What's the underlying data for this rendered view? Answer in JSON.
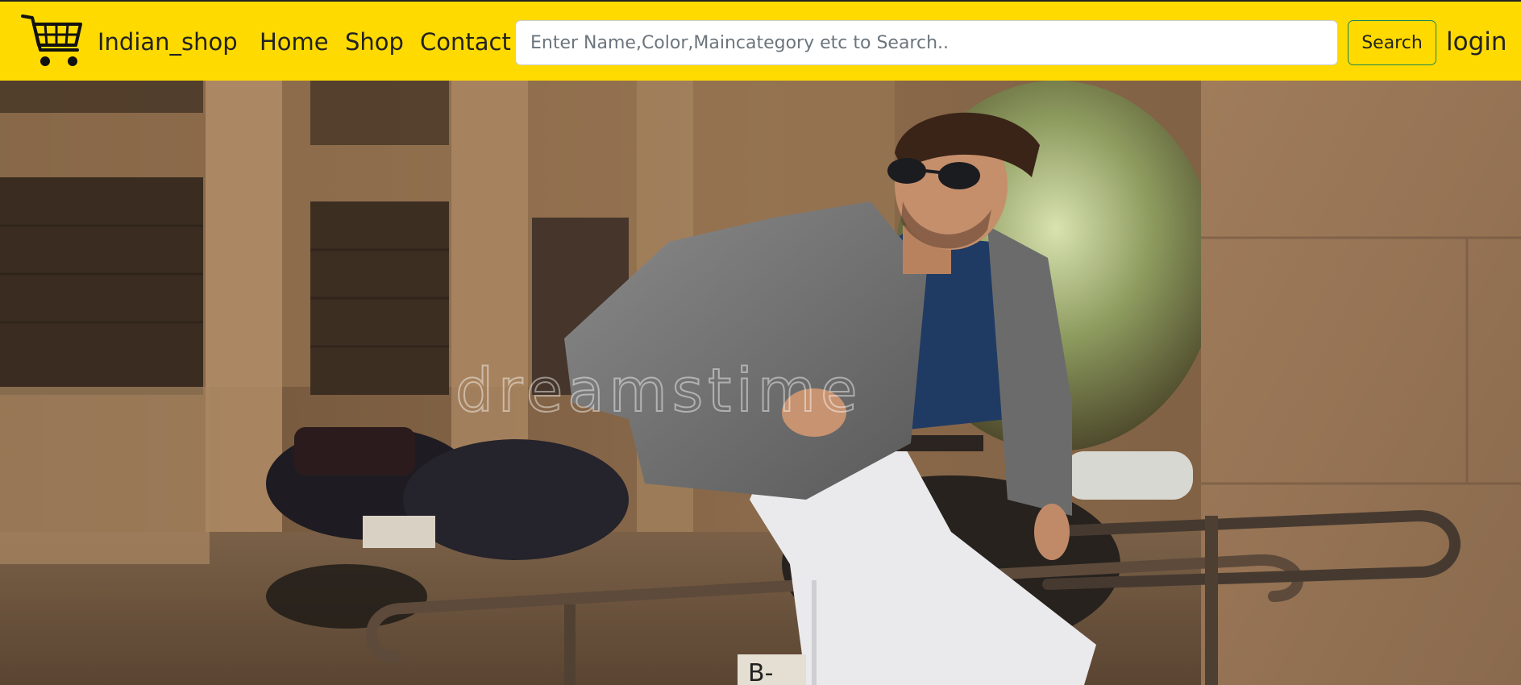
{
  "navbar": {
    "brand": "Indian_shop",
    "logo_icon": "shopping-cart-icon",
    "links": {
      "home": "Home",
      "shop": "Shop",
      "contact": "Contact"
    },
    "search": {
      "placeholder": "Enter Name,Color,Maincategory etc to Search..",
      "value": "",
      "button_label": "Search"
    },
    "login_label": "login"
  },
  "hero": {
    "watermark": "dreamstime",
    "plate_text": "B-"
  },
  "colors": {
    "navbar_bg": "#ffda00",
    "search_button_border": "#198754",
    "text": "#222222"
  }
}
